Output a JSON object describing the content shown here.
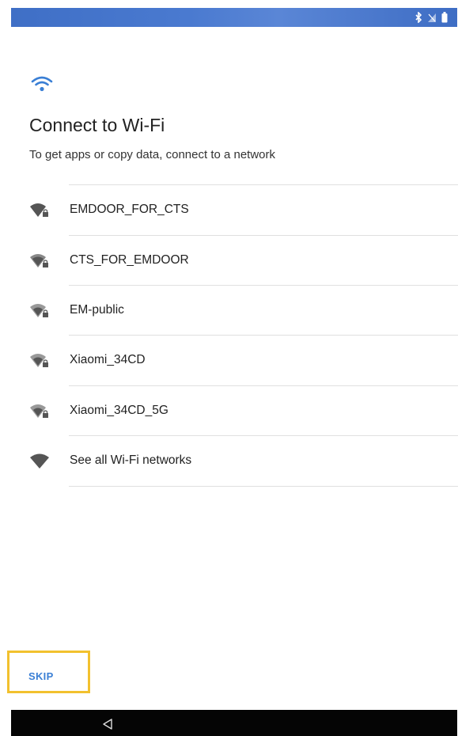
{
  "status_bar": {
    "icons": [
      "bluetooth-icon",
      "signal-icon",
      "battery-icon"
    ],
    "color": "#4274c8"
  },
  "header": {
    "icon": "wifi-icon",
    "title": "Connect to Wi-Fi",
    "subtitle": "To get apps or copy data, connect to a network"
  },
  "networks": [
    {
      "label": "EMDOOR_FOR_CTS",
      "icon": "wifi-lock-icon"
    },
    {
      "label": "CTS_FOR_EMDOOR",
      "icon": "wifi-lock-icon"
    },
    {
      "label": "EM-public",
      "icon": "wifi-lock-icon"
    },
    {
      "label": "Xiaomi_34CD",
      "icon": "wifi-lock-icon"
    },
    {
      "label": "Xiaomi_34CD_5G",
      "icon": "wifi-lock-icon"
    },
    {
      "label": "See all Wi-Fi networks",
      "icon": "wifi-icon"
    }
  ],
  "footer": {
    "skip_label": "SKIP",
    "accent": "#3a7fd5",
    "highlight": "#f2c12e"
  },
  "nav_bar": {
    "icons": [
      "back-icon"
    ]
  }
}
